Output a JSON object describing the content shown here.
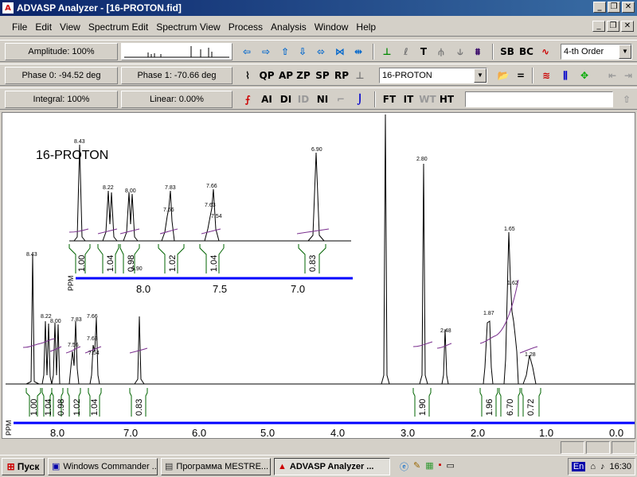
{
  "window": {
    "title": "ADVASP Analyzer - [16-PROTON.fid]",
    "app_icon": "A"
  },
  "menu": [
    "File",
    "Edit",
    "View",
    "Spectrum Edit",
    "Spectrum View",
    "Process",
    "Analysis",
    "Window",
    "Help"
  ],
  "toolbar": {
    "amplitude": "Amplitude: 100%",
    "phase0": "Phase 0: -94.52 deg",
    "phase1": "Phase 1: -70.66 deg",
    "integral": "Integral: 100%",
    "linear": "Linear: 0.00%",
    "baseline_order": "4-th Order",
    "spectrum_select": "16-PROTON",
    "cmd_input": "",
    "btn_qp": "QP",
    "btn_ap": "AP",
    "btn_zp": "ZP",
    "btn_sp": "SP",
    "btn_rp": "RP",
    "btn_ai": "AI",
    "btn_di": "DI",
    "btn_id": "ID",
    "btn_ni": "NI",
    "btn_sb": "SB",
    "btn_bc": "BC",
    "btn_t": "T",
    "btn_ft": "FT",
    "btn_it": "IT",
    "btn_wt": "WT",
    "btn_ht": "HT",
    "accent": "#0000ff"
  },
  "spectrum": {
    "title": "16-PROTON",
    "ppm_label": "PPM",
    "axis_ticks": [
      "8.0",
      "7.0",
      "6.0",
      "5.0",
      "4.0",
      "3.0",
      "2.0",
      "1.0",
      "0.0"
    ],
    "peak_labels": [
      "8.43",
      "8.22",
      "8.00",
      "7.83",
      "7.66",
      "7.63",
      "7.56",
      "7.54",
      "6.90",
      "2.80",
      "2.48",
      "1.87",
      "1.65",
      "1.62",
      "1.28"
    ],
    "integrals": [
      "1.00",
      "1.04",
      "0.98",
      "1.02",
      "1.04",
      "0.83",
      "1.90",
      "1.96",
      "6.70",
      "0.72"
    ],
    "inset": {
      "ticks": [
        "8.0",
        "7.5",
        "7.0"
      ],
      "peak_labels": [
        "8.43",
        "8.22",
        "8.00",
        "7.83",
        "7.66",
        "7.63",
        "7.56",
        "7.54",
        "6.90"
      ],
      "integrals": [
        "1.00",
        "1.04",
        "0.98",
        "1.02",
        "1.04",
        "0.83"
      ]
    }
  },
  "taskbar": {
    "start": "Пуск",
    "items": [
      "Windows Commander ...",
      "Программа MESTRE...",
      "ADVASP Analyzer ..."
    ],
    "lang": "En",
    "clock": "16:30"
  }
}
